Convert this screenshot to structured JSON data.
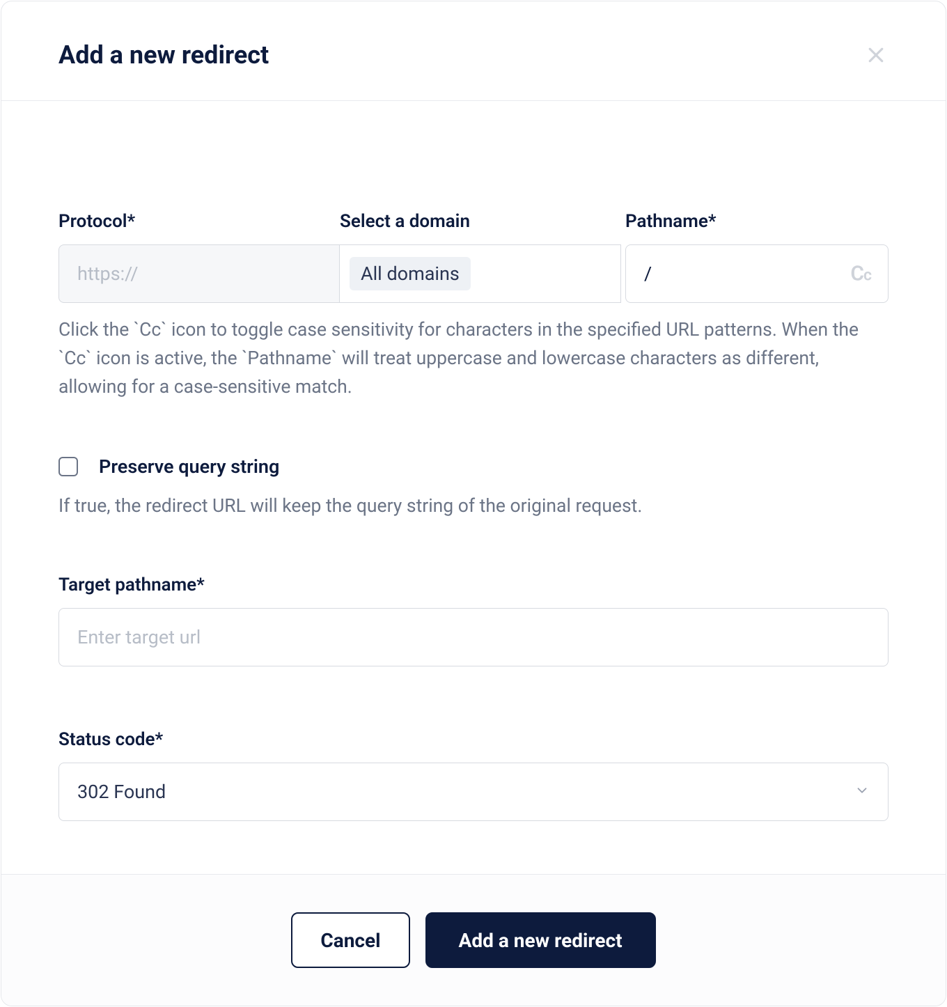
{
  "modal": {
    "title": "Add a new redirect"
  },
  "fields": {
    "protocol": {
      "label": "Protocol*",
      "value": "https://"
    },
    "domain": {
      "label": "Select a domain",
      "value": "All domains"
    },
    "pathname": {
      "label": "Pathname*",
      "value": "/"
    },
    "url_help": "Click the `Cc` icon to toggle case sensitivity for characters in the specified URL patterns. When the `Cc` icon is active, the `Pathname` will treat uppercase and lowercase characters as different, allowing for a case-sensitive match.",
    "preserve": {
      "label": "Preserve query string",
      "help": "If true, the redirect URL will keep the query string of the original request.",
      "checked": false
    },
    "target": {
      "label": "Target pathname*",
      "placeholder": "Enter target url",
      "value": ""
    },
    "status": {
      "label": "Status code*",
      "value": "302 Found"
    }
  },
  "buttons": {
    "cancel": "Cancel",
    "submit": "Add a new redirect"
  }
}
